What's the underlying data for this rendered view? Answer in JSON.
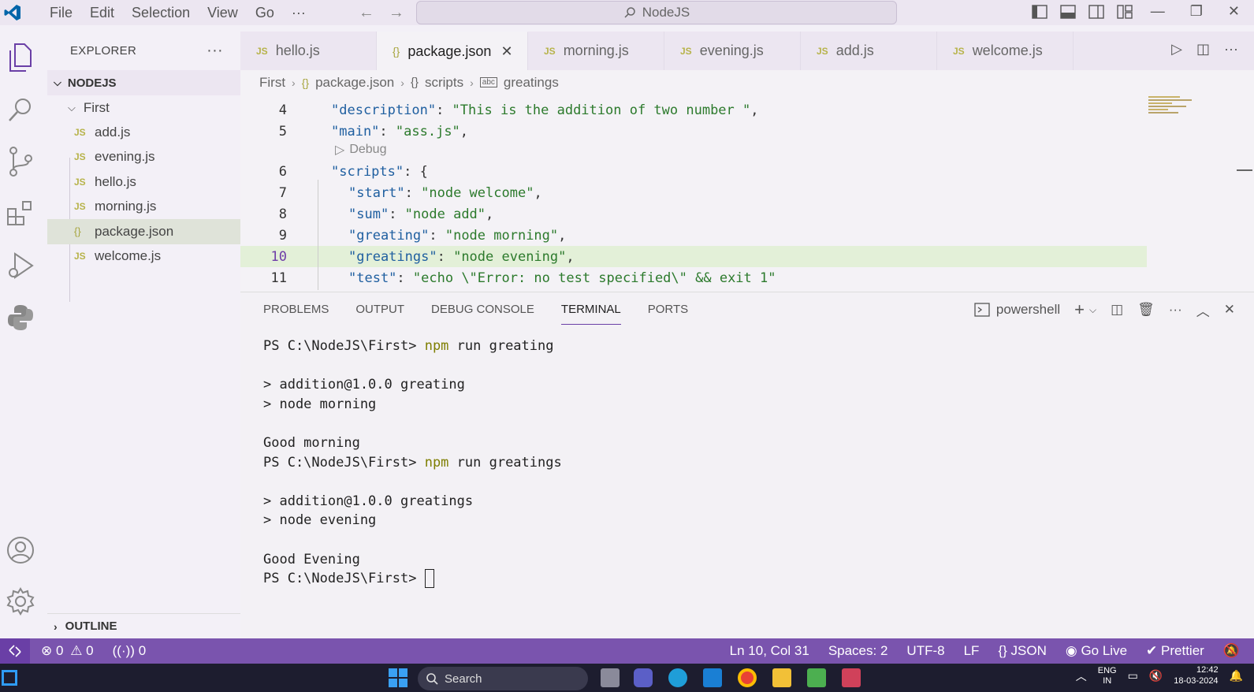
{
  "titlebar": {
    "menu": [
      "File",
      "Edit",
      "Selection",
      "View",
      "Go",
      "···"
    ],
    "search": "NodeJS"
  },
  "sidebar": {
    "title": "EXPLORER",
    "root": "NODEJS",
    "folder": "First",
    "files": [
      {
        "name": "add.js",
        "type": "JS"
      },
      {
        "name": "evening.js",
        "type": "JS"
      },
      {
        "name": "hello.js",
        "type": "JS"
      },
      {
        "name": "morning.js",
        "type": "JS"
      },
      {
        "name": "package.json",
        "type": "{}"
      },
      {
        "name": "welcome.js",
        "type": "JS"
      }
    ],
    "outline": "OUTLINE"
  },
  "tabs": [
    {
      "label": "hello.js",
      "icon": "JS"
    },
    {
      "label": "package.json",
      "icon": "{}"
    },
    {
      "label": "morning.js",
      "icon": "JS"
    },
    {
      "label": "evening.js",
      "icon": "JS"
    },
    {
      "label": "add.js",
      "icon": "JS"
    },
    {
      "label": "welcome.js",
      "icon": "JS"
    }
  ],
  "breadcrumb": {
    "folder": "First",
    "file": "package.json",
    "section": "scripts",
    "item": "greatings"
  },
  "code": {
    "lines": [
      {
        "n": "4",
        "key": "\"description\"",
        "val": "\"This is the addition of two number \"",
        "end": ","
      },
      {
        "n": "5",
        "key": "\"main\"",
        "val": "\"ass.js\"",
        "end": ","
      },
      {
        "n": "6",
        "key": "\"scripts\"",
        "val": "",
        "end": "{"
      },
      {
        "n": "7",
        "key": "\"start\"",
        "val": "\"node welcome\"",
        "end": ","
      },
      {
        "n": "8",
        "key": "\"sum\"",
        "val": "\"node add\"",
        "end": ","
      },
      {
        "n": "9",
        "key": "\"greating\"",
        "val": "\"node morning\"",
        "end": ","
      },
      {
        "n": "10",
        "key": "\"greatings\"",
        "val": "\"node evening\"",
        "end": ","
      },
      {
        "n": "11",
        "key": "\"test\"",
        "val": "\"echo \\\"Error: no test specified\\\" && exit 1\"",
        "end": ""
      }
    ],
    "codelens": "Debug"
  },
  "panel": {
    "tabs": [
      "PROBLEMS",
      "OUTPUT",
      "DEBUG CONSOLE",
      "TERMINAL",
      "PORTS"
    ],
    "shell": "powershell",
    "terminal": {
      "prompt": "PS C:\\NodeJS\\First> ",
      "l1_npm": "npm",
      "l1_rest": " run greating",
      "l2": "> addition@1.0.0 greating",
      "l3": "> node morning",
      "l4": "Good morning",
      "l5_npm": "npm",
      "l5_rest": " run greatings",
      "l6": "> addition@1.0.0 greatings",
      "l7": "> node evening",
      "l8": "Good Evening"
    }
  },
  "statusbar": {
    "errors": "0",
    "warnings": "0",
    "ports": "0",
    "position": "Ln 10, Col 31",
    "spaces": "Spaces: 2",
    "encoding": "UTF-8",
    "eol": "LF",
    "language": "JSON",
    "golive": "Go Live",
    "prettier": "Prettier"
  },
  "taskbar": {
    "search": "Search",
    "lang": "ENG",
    "region": "IN",
    "time": "12:42",
    "date": "18-03-2024"
  },
  "colors": {
    "accent": "#7a54ae",
    "status": "#7a54ae",
    "vscode_blue": "#0065a9",
    "js_icon": "#b7b34a"
  }
}
